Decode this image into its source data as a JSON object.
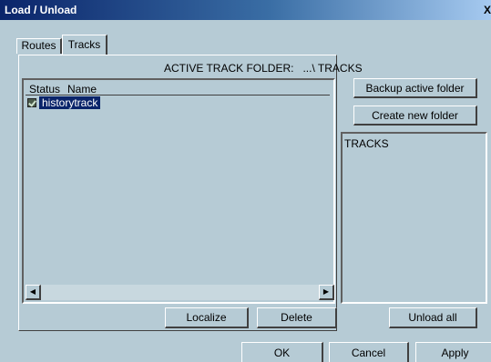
{
  "window": {
    "title": "Load / Unload",
    "close_label": "X"
  },
  "tabs": [
    {
      "label": "Routes",
      "active": false
    },
    {
      "label": "Tracks",
      "active": true
    }
  ],
  "folder_header": "ACTIVE TRACK FOLDER:   ...\\ TRACKS",
  "track_list": {
    "columns": [
      "Status",
      "Name"
    ],
    "rows": [
      {
        "status": "checked",
        "name": "historytrack",
        "selected": true
      }
    ]
  },
  "buttons": {
    "backup": "Backup active folder",
    "create": "Create new folder",
    "localize": "Localize",
    "delete": "Delete",
    "unload_all": "Unload all",
    "ok": "OK",
    "cancel": "Cancel",
    "apply": "Apply"
  },
  "folder_list": {
    "items": [
      "TRACKS"
    ]
  },
  "icons": {
    "scroll_left": "scroll-left-arrow-icon",
    "scroll_right": "scroll-right-arrow-icon",
    "check": "checkbox-checked-icon"
  },
  "colors": {
    "background": "#b6cbd5",
    "title_bar": "#0a246a",
    "selection": "#0a246a"
  }
}
